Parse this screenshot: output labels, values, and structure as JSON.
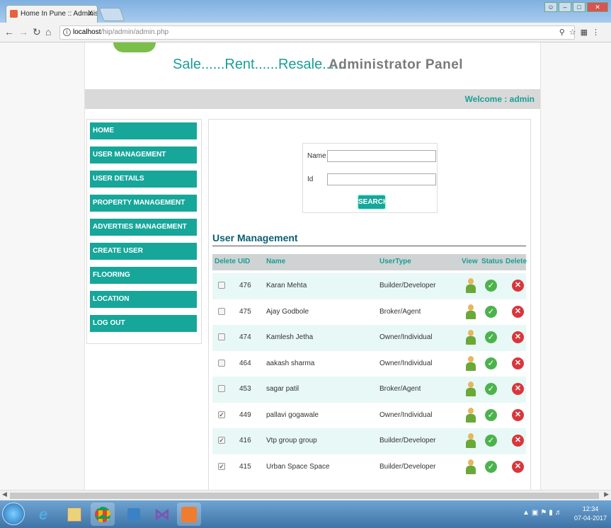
{
  "browser": {
    "tab_title": "Home In Pune :: Adminis",
    "tab_close": "X",
    "url_host": "localhost",
    "url_path": "/hip/admin/admin.php"
  },
  "header": {
    "headline": "Sale......Rent......Resale......",
    "subhead": "Administrator Panel",
    "welcome": "Welcome :  admin"
  },
  "sidebar": {
    "items": [
      {
        "label": "HOME"
      },
      {
        "label": "USER MANAGEMENT"
      },
      {
        "label": "USER DETAILS"
      },
      {
        "label": "PROPERTY MANAGEMENT"
      },
      {
        "label": "ADVERTIES MANAGEMENT"
      },
      {
        "label": "CREATE USER"
      },
      {
        "label": "FLOORING"
      },
      {
        "label": "LOCATION"
      },
      {
        "label": "LOG OUT"
      }
    ]
  },
  "search": {
    "name_label": "Name",
    "id_label": "Id",
    "button_label": "SEARCH"
  },
  "user_management": {
    "title": "User Management",
    "columns": [
      "Delete",
      "UID",
      "Name",
      "UserType",
      "View",
      "Status",
      "Delete"
    ],
    "rows": [
      {
        "uid": "476",
        "name": "Karan Mehta",
        "type": "Builder/Developer",
        "checked": false
      },
      {
        "uid": "475",
        "name": "Ajay Godbole",
        "type": "Broker/Agent",
        "checked": false
      },
      {
        "uid": "474",
        "name": "Kamlesh Jetha",
        "type": "Owner/Individual",
        "checked": false
      },
      {
        "uid": "464",
        "name": "aakash sharma",
        "type": "Owner/Individual",
        "checked": false
      },
      {
        "uid": "453",
        "name": "sagar patil",
        "type": "Broker/Agent",
        "checked": false
      },
      {
        "uid": "449",
        "name": "pallavi gogawale",
        "type": "Owner/Individual",
        "checked": true
      },
      {
        "uid": "416",
        "name": "Vtp group group",
        "type": "Builder/Developer",
        "checked": true
      },
      {
        "uid": "415",
        "name": "Urban Space Space",
        "type": "Builder/Developer",
        "checked": true
      }
    ]
  },
  "taskbar": {
    "time": "12:34",
    "date": "07-04-2017"
  }
}
